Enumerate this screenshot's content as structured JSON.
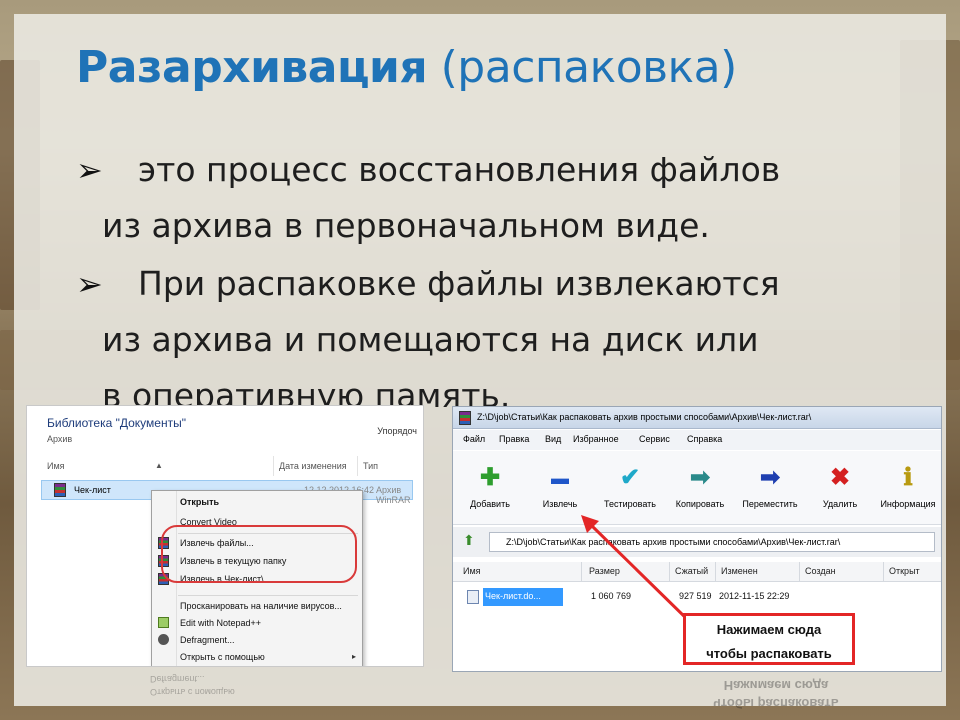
{
  "slide": {
    "title_bold": "Разархивация",
    "title_light": "(распаковка)",
    "bullet_mark": "➢",
    "bullets": [
      {
        "line1": "это процесс восстановления файлов",
        "line2": "из архива в первоначальном виде."
      },
      {
        "line1": "При распаковке файлы извлекаются",
        "line2": "из архива и помещаются на диск или",
        "line3": "в оперативную память."
      }
    ],
    "title_color": "#1f73b7"
  },
  "explorer": {
    "title": "Библиотека \"Документы\"",
    "subtitle": "Архив",
    "sort": "Упорядоч",
    "columns": [
      "Имя",
      "Дата изменения",
      "Тип"
    ],
    "file": {
      "name": "Чек-лист",
      "date": "12.12.2012 16:42",
      "type": "Архив WinRAR",
      "icon": "winrar-archive-icon"
    },
    "menu": {
      "open": "Открыть",
      "convert": "Convert Video",
      "extract_files": "Извлечь файлы...",
      "extract_here": "Извлечь в текущую папку",
      "extract_to": "Извлечь в Чек-лист\\",
      "scan": "Просканировать на наличие вирусов...",
      "notepad": "Edit with Notepad++",
      "defrag": "Defragment...",
      "open_with": "Открыть с помощью",
      "open_with_arrow": "▸"
    },
    "highlight_color": "#d93a3a"
  },
  "winrar": {
    "window_title": "Z:\\D\\job\\Статьи\\Как распаковать архив простыми способами\\Архив\\Чек-лист.rar\\",
    "menus": [
      "Файл",
      "Правка",
      "Вид",
      "Избранное",
      "Сервис",
      "Справка"
    ],
    "tools": [
      {
        "label": "Добавить",
        "glyph": "✚",
        "color": "#2e9e2e",
        "icon": "add-icon"
      },
      {
        "label": "Извлечь",
        "glyph": "▬",
        "color": "#1f56c9",
        "icon": "extract-icon"
      },
      {
        "label": "Тестировать",
        "glyph": "✔",
        "color": "#1fa9c9",
        "icon": "test-icon"
      },
      {
        "label": "Копировать",
        "glyph": "➡",
        "color": "#2a8a8a",
        "icon": "copy-icon"
      },
      {
        "label": "Переместить",
        "glyph": "➡",
        "color": "#1f3fb0",
        "icon": "move-icon"
      },
      {
        "label": "Удалить",
        "glyph": "✖",
        "color": "#d42020",
        "icon": "delete-icon"
      },
      {
        "label": "Информация",
        "glyph": "ℹ",
        "color": "#b89a10",
        "icon": "info-icon"
      }
    ],
    "path": "Z:\\D\\job\\Статьи\\Как распаковать архив простыми способами\\Архив\\Чек-лист.rar\\",
    "columns": [
      "Имя",
      "Размер",
      "Сжатый",
      "Изменен",
      "Создан",
      "Открыт"
    ],
    "row": {
      "name": "Чек-лист.do...",
      "size": "1 060 769",
      "packed": "927 519",
      "modified": "2012-11-15 22:29"
    },
    "callout_line1": "Нажимаем сюда",
    "callout_line2": "чтобы распаковать",
    "arrow_color": "#e32626"
  }
}
